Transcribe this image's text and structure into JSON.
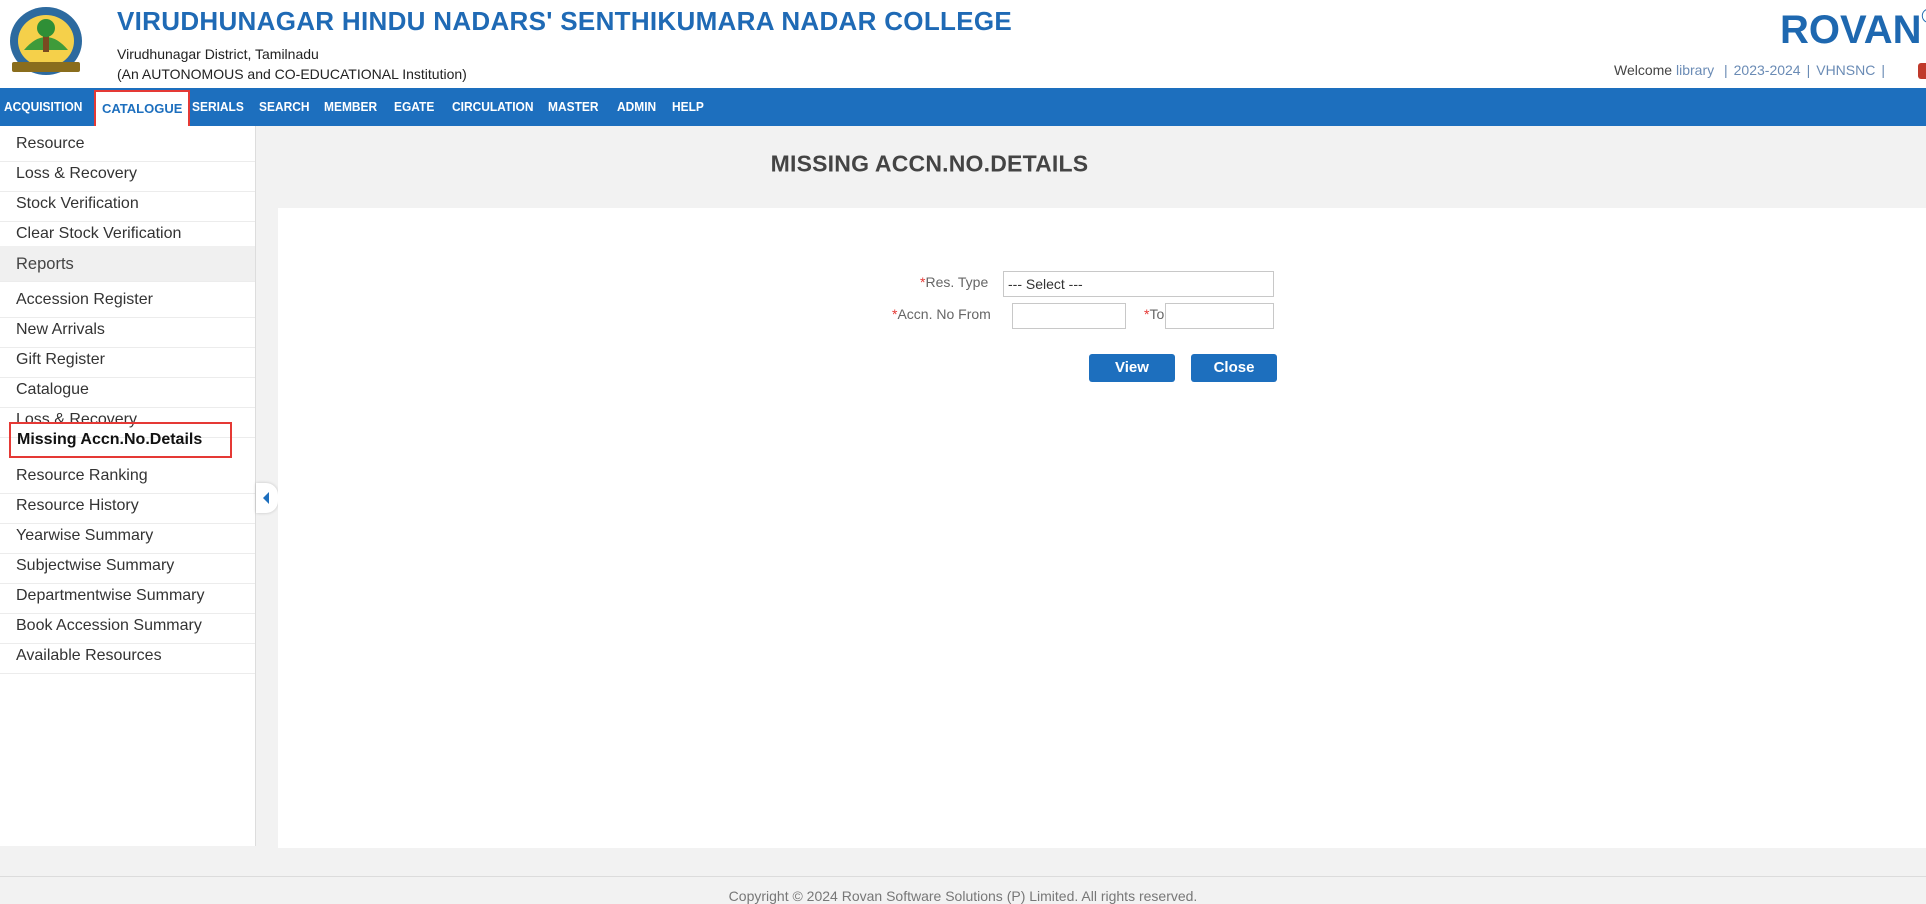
{
  "header": {
    "college_name": "VIRUDHUNAGAR HINDU NADARS' SENTHIKUMARA NADAR COLLEGE",
    "subtitle_1": "Virudhunagar District, Tamilnadu",
    "subtitle_2": "(An AUTONOMOUS and CO-EDUCATIONAL Institution)",
    "brand": "ROVAN",
    "brand_mark": "®",
    "welcome_label": "Welcome",
    "user": "library",
    "academic_year": "2023-2024",
    "institution_code": "VHNSNC",
    "separator": "|"
  },
  "nav": {
    "items": [
      {
        "label": "ACQUISITION"
      },
      {
        "label": "CATALOGUE",
        "active": true
      },
      {
        "label": "SERIALS"
      },
      {
        "label": "SEARCH"
      },
      {
        "label": "MEMBER"
      },
      {
        "label": "EGATE"
      },
      {
        "label": "CIRCULATION"
      },
      {
        "label": "MASTER"
      },
      {
        "label": "ADMIN"
      },
      {
        "label": "HELP"
      }
    ]
  },
  "sidebar": {
    "items": [
      {
        "label": "Resource"
      },
      {
        "label": "Loss & Recovery"
      },
      {
        "label": "Stock Verification"
      },
      {
        "label": "Clear Stock Verification"
      },
      {
        "label": "Reports",
        "header": true
      },
      {
        "label": "Accession Register"
      },
      {
        "label": "New Arrivals"
      },
      {
        "label": "Gift Register"
      },
      {
        "label": "Catalogue"
      },
      {
        "label": "Loss & Recovery"
      },
      {
        "label": "Missing Accn.No.Details",
        "selected": true
      },
      {
        "label": "Resource Ranking"
      },
      {
        "label": "Resource History"
      },
      {
        "label": "Yearwise Summary"
      },
      {
        "label": "Subjectwise Summary"
      },
      {
        "label": "Departmentwise Summary"
      },
      {
        "label": "Book Accession Summary"
      },
      {
        "label": "Available Resources"
      }
    ]
  },
  "main": {
    "title": "MISSING ACCN.NO.DETAILS",
    "form": {
      "required_mark": "*",
      "res_type_label": "Res. Type",
      "res_type_value": "--- Select ---",
      "accn_from_label": "Accn. No From",
      "accn_from_value": "",
      "accn_to_label": "To",
      "accn_to_value": "",
      "view_button": "View",
      "close_button": "Close"
    }
  },
  "footer": {
    "copyright": "Copyright © 2024 Rovan Software Solutions (P) Limited. All rights reserved."
  },
  "colors": {
    "nav_bg": "#1d6fbe",
    "title_blue": "#1f6ab5",
    "highlight_red": "#e53935"
  }
}
